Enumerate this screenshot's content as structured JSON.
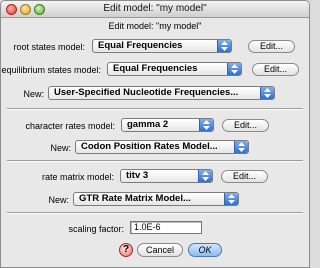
{
  "window": {
    "title": "Edit model: \"my model\""
  },
  "dialog": {
    "heading": "Edit model: \"my model\""
  },
  "root_states": {
    "label": "root states model:",
    "selected": "Equal Frequencies",
    "edit_label": "Edit..."
  },
  "equilibrium_states": {
    "label": "equilibrium states model:",
    "selected": "Equal Frequencies",
    "edit_label": "Edit...",
    "new_label": "New:",
    "new_selected": "User-Specified Nucleotide Frequencies..."
  },
  "character_rates": {
    "label": "character rates model:",
    "selected": "gamma 2",
    "edit_label": "Edit...",
    "new_label": "New:",
    "new_selected": "Codon Position Rates Model..."
  },
  "rate_matrix": {
    "label": "rate matrix model:",
    "selected": "titv 3",
    "edit_label": "Edit...",
    "new_label": "New:",
    "new_selected": "GTR Rate Matrix Model..."
  },
  "scaling": {
    "label": "scaling factor:",
    "value": "1.0E-6"
  },
  "buttons": {
    "help": "?",
    "cancel": "Cancel",
    "ok": "OK"
  },
  "colors": {
    "popup_arrow": "#2f6fd0",
    "default_button": "#9cc6f5",
    "help_button": "#ee6f6f"
  }
}
